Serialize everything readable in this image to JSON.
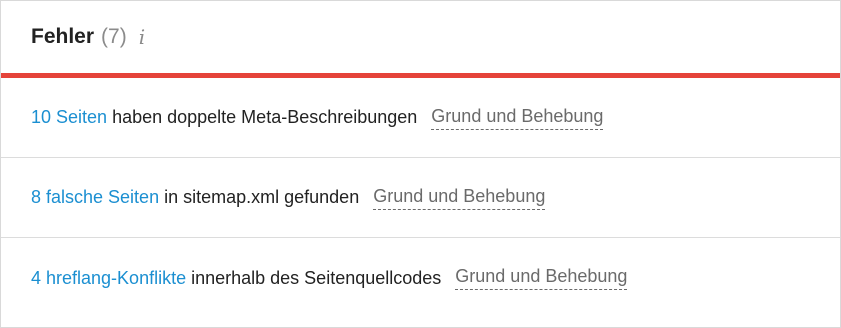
{
  "panel": {
    "title": "Fehler",
    "count": "(7)",
    "info_icon": "i",
    "accent_color": "#e5433a"
  },
  "issues": [
    {
      "link": "10 Seiten",
      "text": "haben doppelte Meta-Beschreibungen",
      "reason": "Grund und Behebung"
    },
    {
      "link": "8 falsche Seiten",
      "text": "in sitemap.xml gefunden",
      "reason": "Grund und Behebung"
    },
    {
      "link": "4 hreflang-Konflikte",
      "text": "innerhalb des Seitenquellcodes",
      "reason": "Grund und Behebung"
    }
  ]
}
